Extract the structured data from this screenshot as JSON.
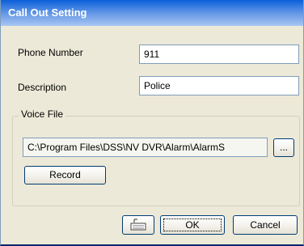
{
  "dialog": {
    "title": "Call Out Setting"
  },
  "fields": {
    "phone_label": "Phone Number",
    "phone_value": "911",
    "description_label": "Description",
    "description_value": "Police"
  },
  "voice_file": {
    "group_label": "Voice File",
    "path": "C:\\Program Files\\DSS\\NV DVR\\Alarm\\AlarmS",
    "browse_label": "...",
    "record_label": "Record"
  },
  "footer": {
    "keyboard_icon": "keyboard-icon",
    "ok_label": "OK",
    "cancel_label": "Cancel"
  },
  "colors": {
    "title_bar": "#2b74df",
    "dialog_bg": "#ece9d8",
    "input_border": "#7f9db9",
    "button_border": "#003c74"
  }
}
